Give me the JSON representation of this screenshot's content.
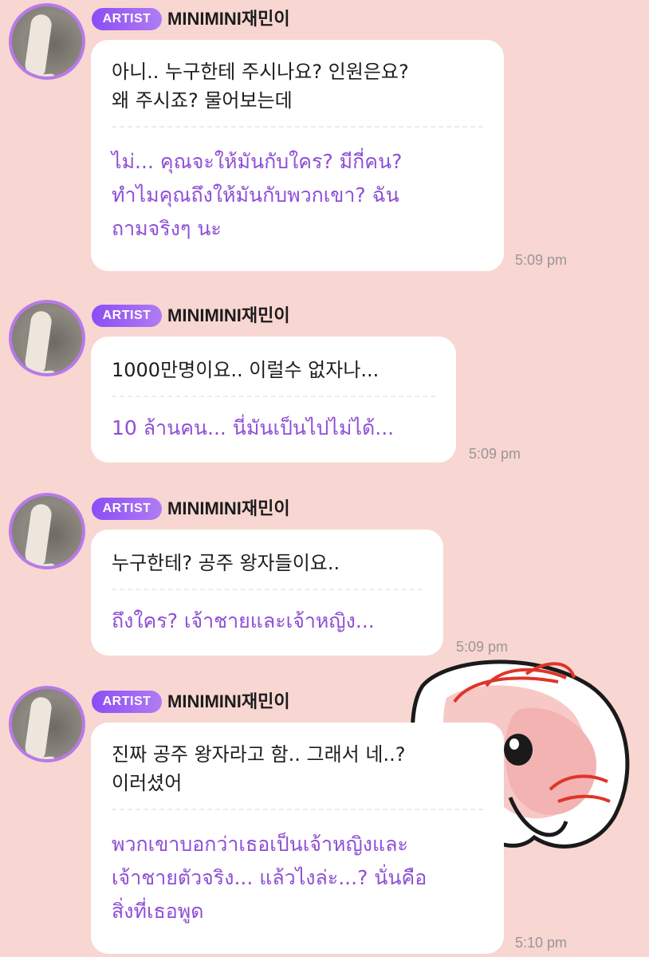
{
  "messages": [
    {
      "badge": "ARTIST",
      "sender": "MINIMINI재민이",
      "original": [
        "아니.. 누구한테 주시나요? 인원은요?",
        "왜 주시죠? 물어보는데"
      ],
      "translation": [
        "ไม่... คุณจะให้มันกับใคร? มีกี่คน?",
        "ทำไมคุณถึงให้มันกับพวกเขา? ฉัน",
        "ถามจริงๆ นะ"
      ],
      "time": "5:09 pm"
    },
    {
      "badge": "ARTIST",
      "sender": "MINIMINI재민이",
      "original": [
        "1000만명이요.. 이럴수 없자나..."
      ],
      "translation": [
        "10 ล้านคน... นี่มันเป็นไปไม่ได้..."
      ],
      "time": "5:09 pm"
    },
    {
      "badge": "ARTIST",
      "sender": "MINIMINI재민이",
      "original": [
        "누구한테? 공주 왕자들이요.."
      ],
      "translation": [
        "ถึงใคร? เจ้าชายและเจ้าหญิง..."
      ],
      "time": "5:09 pm"
    },
    {
      "badge": "ARTIST",
      "sender": "MINIMINI재민이",
      "original": [
        "진짜 공주 왕자라고 함.. 그래서 네..?",
        "이러셨어"
      ],
      "translation": [
        "พวกเขาบอกว่าเธอเป็นเจ้าหญิงและ",
        "เจ้าชายตัวจริง... แล้วไงล่ะ...? นั่นคือ",
        "สิ่งที่เธอพูด"
      ],
      "time": "5:10 pm"
    }
  ],
  "sticker": {
    "icon": "pink-character-sticker"
  },
  "colors": {
    "background": "#f8d6d2",
    "badge": "#8b4df5",
    "translation": "#8e4fd6",
    "bubble": "#ffffff"
  }
}
